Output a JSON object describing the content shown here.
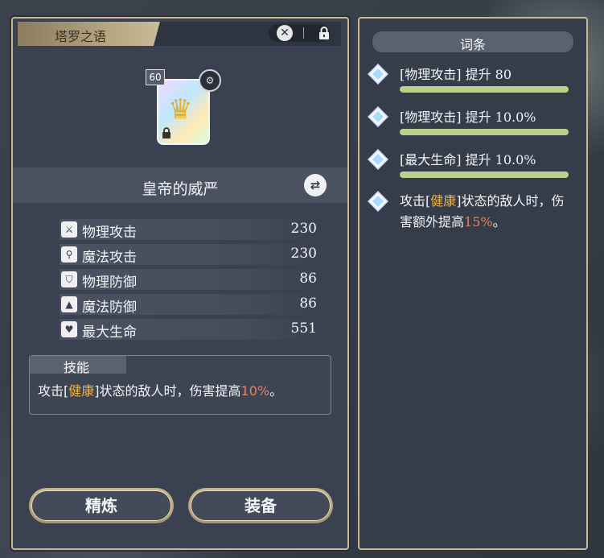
{
  "item_panel": {
    "title": "塔罗之语",
    "level": "60",
    "name": "皇帝的威严",
    "stats": [
      {
        "icon": "sword-icon",
        "label": "物理攻击",
        "value": "230"
      },
      {
        "icon": "wand-icon",
        "label": "魔法攻击",
        "value": "230"
      },
      {
        "icon": "shield-icon",
        "label": "物理防御",
        "value": "86"
      },
      {
        "icon": "hat-icon",
        "label": "魔法防御",
        "value": "86"
      },
      {
        "icon": "heart-icon",
        "label": "最大生命",
        "value": "551"
      }
    ],
    "skill": {
      "title": "技能",
      "desc_part1": "攻击[",
      "desc_keyword": "健康",
      "desc_part2": "]状态的敌人时，伤害提高",
      "desc_value": "10%",
      "desc_part3": "。"
    },
    "buttons": {
      "refine": "精炼",
      "equip": "装备"
    }
  },
  "affix_panel": {
    "title": "词条",
    "affixes": [
      {
        "text": "[物理攻击] 提升 80"
      },
      {
        "text": "[物理攻击] 提升 10.0%"
      },
      {
        "text": "[最大生命] 提升 10.0%"
      }
    ],
    "special": {
      "part1": "攻击[",
      "keyword": "健康",
      "part2": "]状态的敌人时，伤害额外提高",
      "value": "15%",
      "part3": "。"
    }
  },
  "colors": {
    "gold_border": "#c9b890",
    "highlight_gold": "#f2b23e",
    "highlight_red": "#e98161",
    "bar_green": "#b9d18a"
  }
}
